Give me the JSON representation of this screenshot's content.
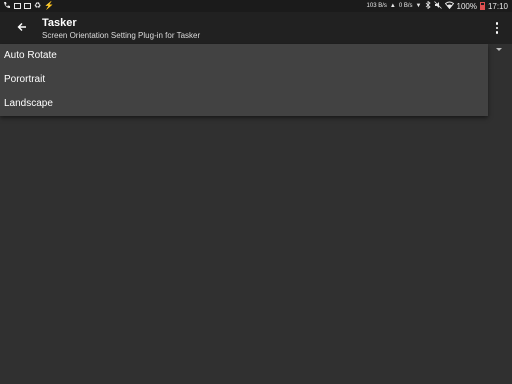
{
  "status_bar": {
    "net_up": "103 B/s",
    "net_down": "0 B/s",
    "battery_percent": "100%",
    "time": "17:10"
  },
  "toolbar": {
    "title": "Tasker",
    "subtitle": "Screen Orientation Setting Plug-in for Tasker"
  },
  "dropdown": {
    "options": [
      "Auto Rotate",
      "Porortrait",
      "Landscape"
    ]
  },
  "colors": {
    "background": "#303030",
    "toolbar": "#212121",
    "status_bar": "#1b1b1b",
    "dropdown": "#424242",
    "battery": "#e05050"
  },
  "icons": {
    "status_left": [
      "phone-icon",
      "message-icon",
      "notification-icon",
      "recycle-icon",
      "flash-icon"
    ],
    "status_right": [
      "upload-arrow-icon",
      "download-arrow-icon",
      "bluetooth-icon",
      "mute-icon",
      "wifi-icon",
      "battery-icon"
    ],
    "toolbar": [
      "back-arrow-icon",
      "overflow-menu-icon"
    ]
  }
}
